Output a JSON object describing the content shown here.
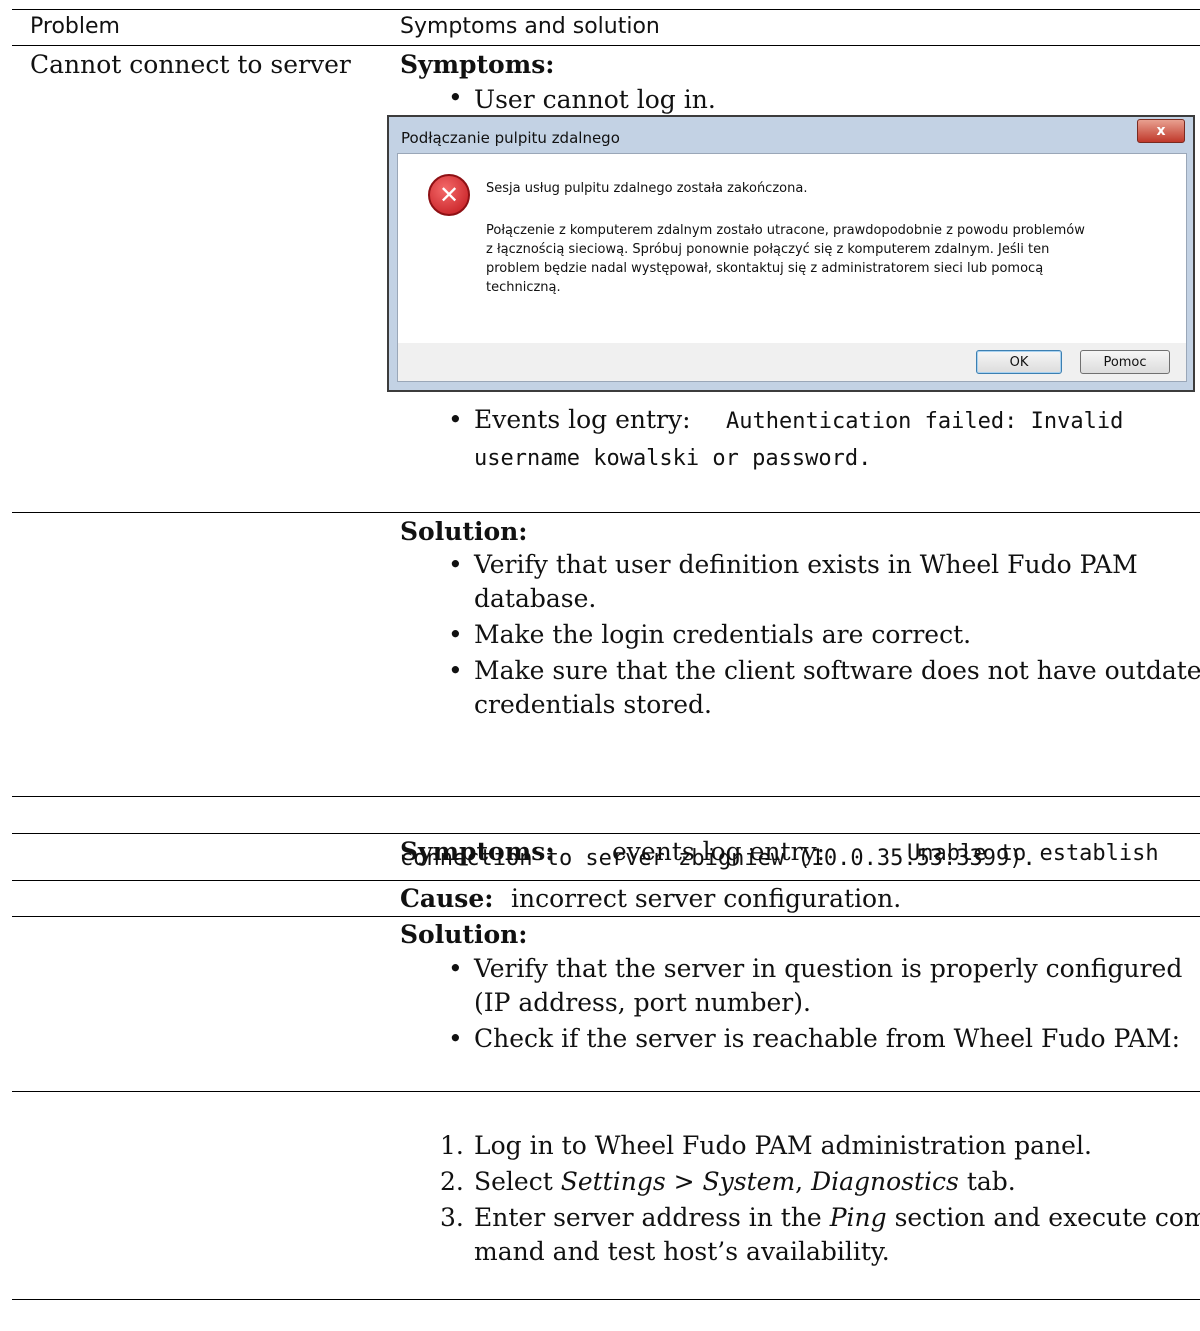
{
  "table": {
    "header_problem": "Problem",
    "header_symptoms": "Symptoms and solution",
    "problem": "Cannot connect to server"
  },
  "block1": {
    "symptoms_label": "Symptoms:",
    "bullet1": "User cannot log in.",
    "bullet2_prefix": "Events log entry:",
    "bullet2_code_line1": "Authentication failed:  Invalid",
    "bullet2_code_line2": "username kowalski or password."
  },
  "dialog": {
    "title": "Podłączanie pulpitu zdalnego",
    "close": "x",
    "heading": "Sesja usług pulpitu zdalnego została zakończona.",
    "message_line1": "Połączenie z komputerem zdalnym zostało utracone, prawdopodobnie z powodu problemów",
    "message_line2": "z łącznością sieciową. Spróbuj ponownie połączyć się z komputerem zdalnym. Jeśli ten",
    "message_line3": "problem będzie nadal występował, skontaktuj się z administratorem sieci lub pomocą",
    "message_line4": "techniczną.",
    "ok_label": "OK",
    "help_label": "Pomoc"
  },
  "block2": {
    "solution_label": "Solution:",
    "bullet1_line1": "Verify that user definition exists in Wheel Fudo PAM",
    "bullet1_line2": "database.",
    "bullet2": "Make the login credentials are correct.",
    "bullet3_line1": "Make sure that the client software does not have outdated",
    "bullet3_line2": "credentials stored."
  },
  "block3": {
    "symptoms_label": "Symptoms:",
    "symptoms_text": "events log entry:",
    "code_line1": "Unable to establish",
    "code_line2": "connection to server zbigniew (10.0.35.53:3399).",
    "cause_label": "Cause:",
    "cause_text": "incorrect server configuration.",
    "solution_label": "Solution:",
    "bullet1_line1": "Verify that the server in question is properly configured",
    "bullet1_line2": "(IP address, port number).",
    "bullet2": "Check if the server is reachable from Wheel Fudo PAM:"
  },
  "steps": {
    "n1": "1.",
    "s1": "Log in to Wheel Fudo PAM administration panel.",
    "n2": "2.",
    "s2_a": "Select",
    "s2_settings": "Settings",
    "s2_gt": ">",
    "s2_system": "System",
    "s2_comma": ",",
    "s2_diag": "Diagnostics",
    "s2_tab": "tab.",
    "n3": "3.",
    "s3_a": "Enter server address in the",
    "s3_ping": "Ping",
    "s3_b": "section and execute com-",
    "s3_line2": "mand and test host’s availability."
  }
}
